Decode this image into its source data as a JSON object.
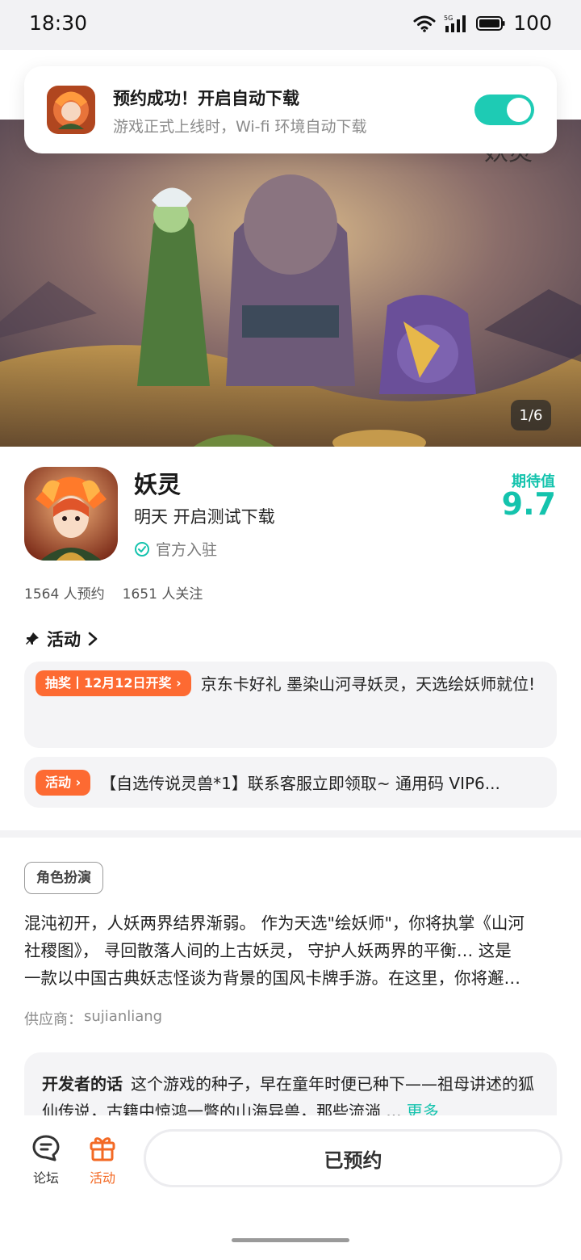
{
  "status_bar": {
    "time": "18:30",
    "network": "5G",
    "battery": "100"
  },
  "toast": {
    "title": "预约成功！开启自动下载",
    "subtitle": "游戏正式上线时，Wi-fi 环境自动下载",
    "toggle_on": true
  },
  "hero": {
    "page_indicator": "1/6",
    "current_page": 1,
    "total_pages": 6
  },
  "app": {
    "name": "妖灵",
    "release": "明天 开启测试下载",
    "official": "官方入驻",
    "expect_label": "期待值",
    "expect_score": "9.7",
    "reservations": "1564 人预约",
    "followers": "1651 人关注"
  },
  "activity": {
    "heading": "活动",
    "items": [
      {
        "badge": "抽奖丨12月12日开奖",
        "text": "京东卡好礼 墨染山河寻妖灵，天选绘妖师就位!"
      },
      {
        "badge": "活动",
        "text": "【自选传说灵兽*1】联系客服立即领取~ 通用码 VIP6..."
      }
    ]
  },
  "description": {
    "tag": "角色扮演",
    "lines": [
      "混沌初开，人妖两界结界渐弱。 作为天选\"绘妖师\"，你将执掌《山河",
      "社稷图》， 寻回散落人间的上古妖灵， 守护人妖两界的平衡… 这是",
      "一款以中国古典妖志怪谈为背景的国风卡牌手游。在这里，你将邂…"
    ],
    "supplier_label": "供应商：",
    "supplier": "sujianliang"
  },
  "developer": {
    "label": "开发者的话",
    "text": "这个游戏的种子，早在童年时便已种下——祖母讲述的狐仙传说，古籍中惊鸿一瞥的山海异兽，那些流淌 ...",
    "more": "更多"
  },
  "bottom_nav": {
    "forum": "论坛",
    "activity": "活动",
    "reserved_button": "已预约"
  },
  "colors": {
    "accent": "#14c3ad",
    "badge": "#fd6a32",
    "active_nav": "#f36a25"
  }
}
